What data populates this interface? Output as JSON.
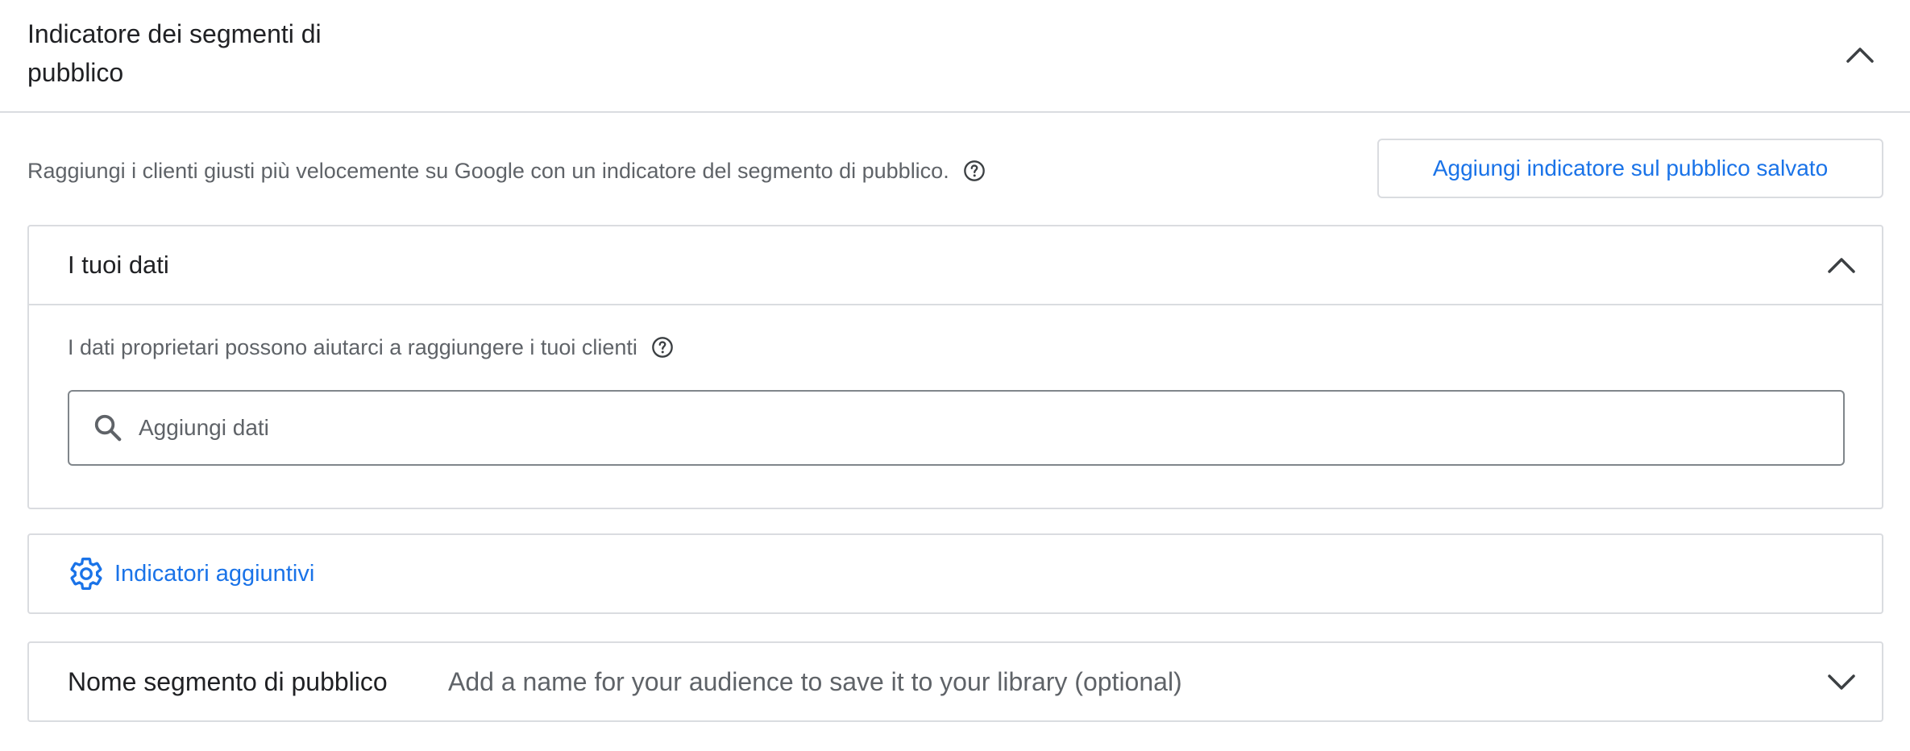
{
  "header": {
    "title": "Indicatore dei segmenti di pubblico",
    "collapse_icon": "chevron-up-icon"
  },
  "intro": {
    "text": "Raggiungi i clienti giusti più velocemente su Google con un indicatore del segmento di pubblico.",
    "help_icon": "help-circle-icon",
    "saved_button_label": "Aggiungi indicatore sul pubblico salvato"
  },
  "your_data": {
    "title": "I tuoi dati",
    "collapse_icon": "chevron-up-icon",
    "description": "I dati proprietari possono aiutarci a raggiungere i tuoi clienti",
    "help_icon": "help-circle-icon",
    "search_icon": "search-icon",
    "search_placeholder": "Aggiungi dati",
    "search_value": ""
  },
  "additional": {
    "icon": "gear-icon",
    "label": "Indicatori aggiuntivi"
  },
  "segment_name": {
    "label": "Nome segmento di pubblico",
    "hint": "Add a name for your audience to save it to your library (optional)",
    "expand_icon": "chevron-down-icon"
  },
  "colors": {
    "accent": "#1a73e8",
    "border": "#dadce0",
    "text_primary": "#202124",
    "text_secondary": "#5f6368",
    "background": "#f8f9fa"
  }
}
